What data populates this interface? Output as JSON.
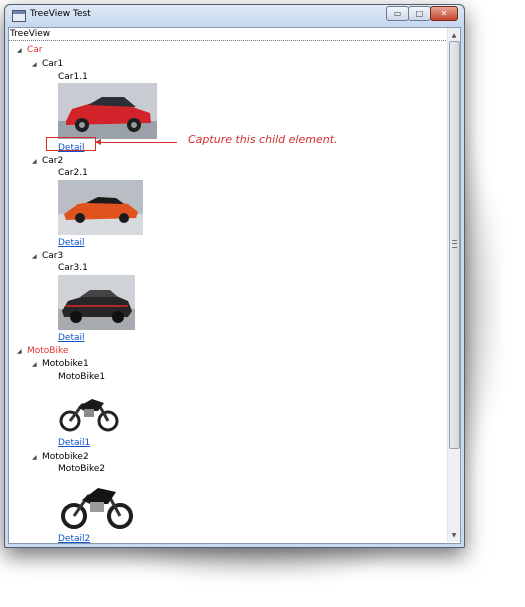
{
  "window": {
    "title": "TreeView Test",
    "minimize_glyph": "▭",
    "maximize_glyph": "□",
    "close_glyph": "✕"
  },
  "header": {
    "label": "TreeView"
  },
  "tree": {
    "expander_glyph": "◢",
    "car_group": {
      "label": "Car",
      "items": [
        {
          "label": "Car1",
          "child": "Car1.1",
          "link": "Detail"
        },
        {
          "label": "Car2",
          "child": "Car2.1",
          "link": "Detail"
        },
        {
          "label": "Car3",
          "child": "Car3.1",
          "link": "Detail"
        }
      ]
    },
    "moto_group": {
      "label": "MotoBike",
      "items": [
        {
          "label": "Motobike1",
          "child": "MotoBike1",
          "link": "Detail1"
        },
        {
          "label": "Motobike2",
          "child": "MotoBike2",
          "link": "Detail2"
        }
      ]
    }
  },
  "annotation": {
    "text": "Capture this child element."
  },
  "colors": {
    "group_label": "#e03030",
    "link": "#1155cc",
    "annotation": "#d23030"
  }
}
